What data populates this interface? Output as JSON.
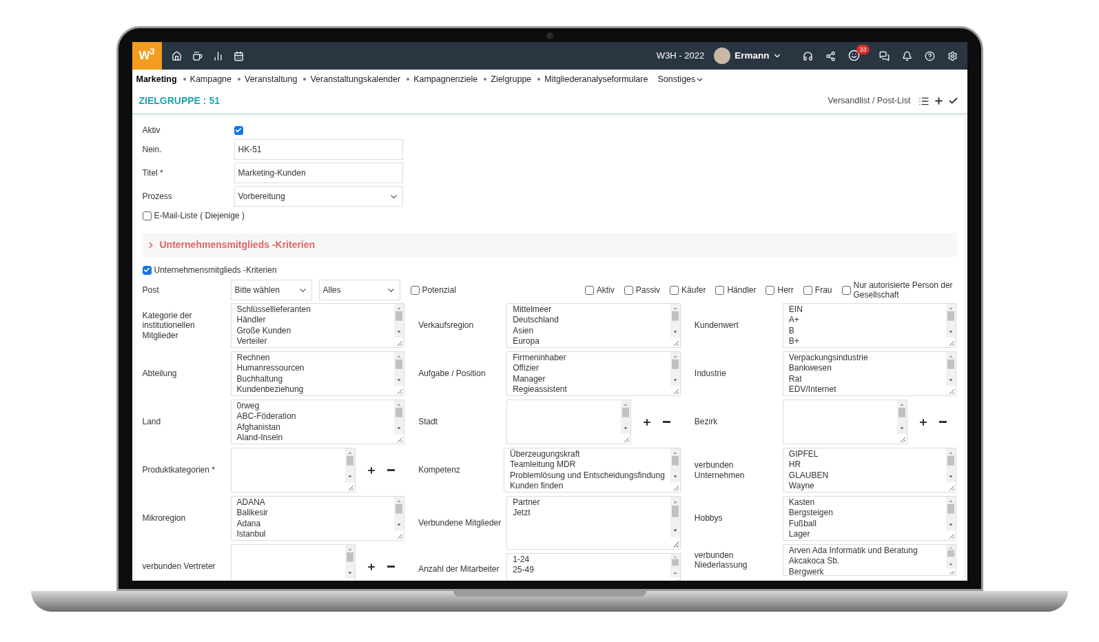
{
  "header": {
    "logo": "W$^{3}$",
    "workspace": "W3H - 2022",
    "user": "Ermann",
    "badge": "33"
  },
  "menu": [
    {
      "label": "Marketing",
      "selected": true
    },
    {
      "label": "Kampagne",
      "selected": false
    },
    {
      "label": "Veranstaltung",
      "selected": false
    },
    {
      "label": "Veranstaltungskalender",
      "selected": false
    },
    {
      "label": "Kampagnenziele",
      "selected": false
    },
    {
      "label": "Zielgruppe",
      "selected": false
    },
    {
      "label": "Mitgliederanalyseformulare",
      "selected": false
    },
    {
      "label": "Sonstiges",
      "selected": false,
      "kind": "dropdown"
    }
  ],
  "page": {
    "title": "ZIELGRUPPE : 51",
    "action": "Versandlist / Post-List"
  },
  "form": [
    {
      "kind": "checkbox",
      "label": "Aktiv",
      "checked": true
    },
    {
      "kind": "text",
      "label": "Nein.",
      "value": "HK-51"
    },
    {
      "kind": "text",
      "label": "Titel *",
      "value": "Marketing-Kunden"
    },
    {
      "kind": "select",
      "label": "Prozess",
      "value": "Vorbereitung"
    }
  ],
  "email_list": {
    "label": "E-Mail-Liste ( Diejenige )",
    "checked": false
  },
  "section": {
    "title": "Unternehmensmitglieds -Kriterien"
  },
  "criteria": {
    "label": "Unternehmensmitglieds -Kriterien",
    "checked": true
  },
  "post": {
    "label": "Post",
    "selects": [
      "Bitte wählen",
      "Alles"
    ],
    "checkboxes": [
      {
        "label": "Potenzial",
        "checked": false
      },
      {
        "label": "Aktiv",
        "checked": false
      },
      {
        "label": "Passiv",
        "checked": false
      },
      {
        "label": "Käufer",
        "checked": false
      },
      {
        "label": "Händler",
        "checked": false
      },
      {
        "label": "Herr",
        "checked": false
      },
      {
        "label": "Frau",
        "checked": false
      },
      {
        "label": "Nur autorisierte Person der Gesellschaft",
        "checked": false
      }
    ]
  },
  "columns": [
    [
      {
        "label": "Kategorie der institutionellen Mitglieder",
        "kind": "list",
        "items": [
          "Schlüssellieferanten",
          "Händler",
          "Große Kunden",
          "Verteiler"
        ]
      },
      {
        "label": "Abteilung",
        "kind": "list",
        "items": [
          "Rechnen",
          "Humanressourcen",
          "Buchhaltung",
          "Kundenbeziehung"
        ]
      },
      {
        "label": "Land",
        "kind": "list",
        "items": [
          "0rweg",
          "ABC-Föderation",
          "Afghanistan",
          "Aland-Inseln"
        ]
      },
      {
        "label": "Produktkategorien *",
        "kind": "add"
      },
      {
        "label": "Mikroregion",
        "kind": "list",
        "items": [
          "ADANA",
          "Balikesir",
          "Adana",
          "Istanbul"
        ]
      },
      {
        "label": "verbunden Vertreter",
        "kind": "add"
      }
    ],
    [
      {
        "label": "Verkaufsregion",
        "kind": "list",
        "items": [
          "Mittelmeer",
          "Deutschland",
          "Asien",
          "Europa"
        ]
      },
      {
        "label": "Aufgabe / Position",
        "kind": "list",
        "items": [
          "Firmeninhaber",
          "Offizier",
          "Manager",
          "Regieassistent"
        ]
      },
      {
        "label": "Stadt",
        "kind": "add"
      },
      {
        "label": "Kompetenz",
        "kind": "list",
        "items": [
          "Überzeugungskraft",
          "Teamleitung MDR",
          "Problemlösung und Entscheidungsfindung",
          "Kunden finden"
        ]
      },
      {
        "label": "Verbundene Mitglieder",
        "kind": "tall",
        "items": [
          "Partner",
          "Jetzt"
        ]
      },
      {
        "label": "Anzahl der Mitarbeiter",
        "kind": "short",
        "items": [
          "1-24",
          "25-49"
        ]
      }
    ],
    [
      {
        "label": "Kundenwert",
        "kind": "list",
        "items": [
          "EIN",
          "A+",
          "B",
          "B+"
        ]
      },
      {
        "label": "Industrie",
        "kind": "list",
        "items": [
          "Verpackungsindustrie",
          "Bankwesen",
          "Rat",
          "EDV/Internet"
        ]
      },
      {
        "label": "Bezirk",
        "kind": "add"
      },
      {
        "label": "verbunden Unternehmen",
        "kind": "list",
        "items": [
          "GIPFEL",
          "HR",
          "GLAUBEN",
          "Wayne"
        ]
      },
      {
        "label": "Hobbys",
        "kind": "list",
        "items": [
          "Kasten",
          "Bergsteigen",
          "Fußball",
          "Lager"
        ]
      },
      {
        "label": "verbunden Niederlassung",
        "kind": "short",
        "items": [
          "Arven Ada Informatik und Beratung",
          "Akcakoca Sb.",
          "Bergwerk"
        ]
      }
    ]
  ]
}
